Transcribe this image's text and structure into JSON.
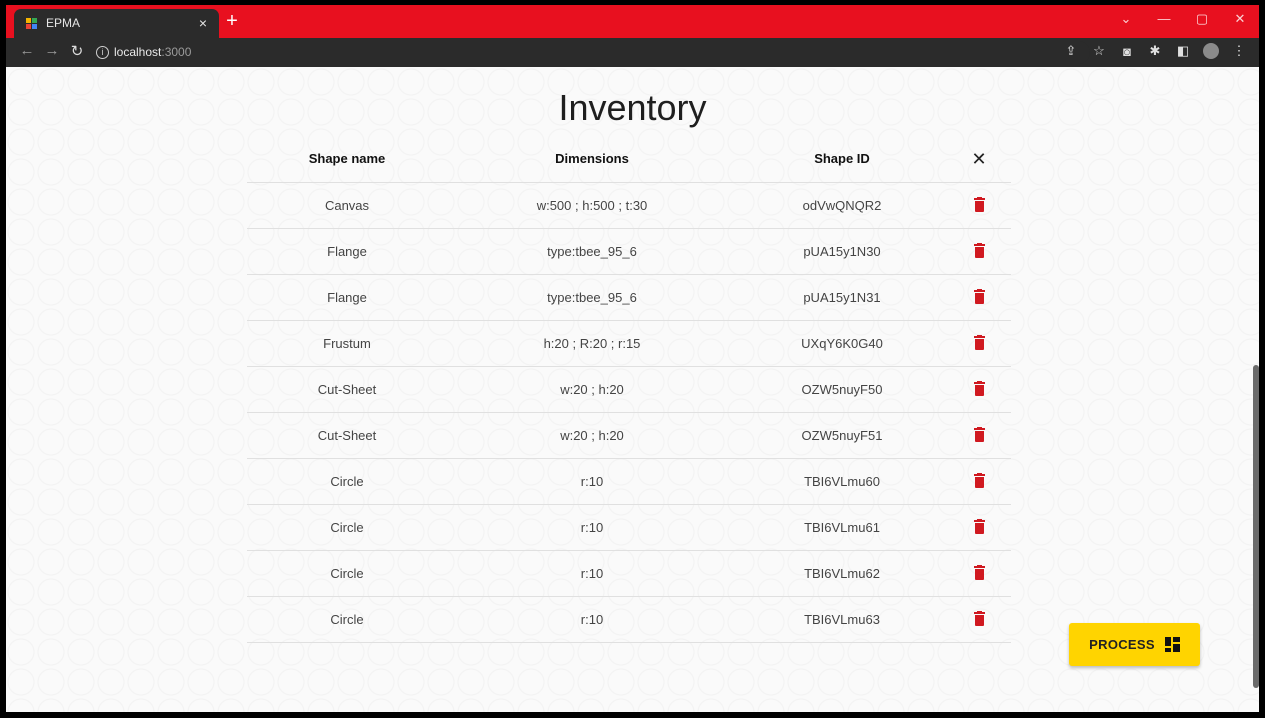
{
  "browser": {
    "tab_title": "EPMA",
    "tab_close": "×",
    "new_tab": "+",
    "url_host": "localhost",
    "url_port": ":3000",
    "colors": {
      "tab_strip": "#e8101f",
      "toolbar": "#2b2b2b"
    }
  },
  "page": {
    "title": "Inventory",
    "columns": [
      "Shape name",
      "Dimensions",
      "Shape ID"
    ],
    "clear_label": "✕",
    "rows": [
      {
        "name": "Canvas",
        "dims": "w:500 ; h:500 ; t:30",
        "id": "odVwQNQR2"
      },
      {
        "name": "Flange",
        "dims": "type:tbee_95_6",
        "id": "pUA15y1N30"
      },
      {
        "name": "Flange",
        "dims": "type:tbee_95_6",
        "id": "pUA15y1N31"
      },
      {
        "name": "Frustum",
        "dims": "h:20 ; R:20 ; r:15",
        "id": "UXqY6K0G40"
      },
      {
        "name": "Cut-Sheet",
        "dims": "w:20 ; h:20",
        "id": "OZW5nuyF50"
      },
      {
        "name": "Cut-Sheet",
        "dims": "w:20 ; h:20",
        "id": "OZW5nuyF51"
      },
      {
        "name": "Circle",
        "dims": "r:10",
        "id": "TBI6VLmu60"
      },
      {
        "name": "Circle",
        "dims": "r:10",
        "id": "TBI6VLmu61"
      },
      {
        "name": "Circle",
        "dims": "r:10",
        "id": "TBI6VLmu62"
      },
      {
        "name": "Circle",
        "dims": "r:10",
        "id": "TBI6VLmu63"
      }
    ],
    "process_label": "PROCESS",
    "colors": {
      "delete": "#d01920",
      "process_button": "#ffd400"
    }
  }
}
